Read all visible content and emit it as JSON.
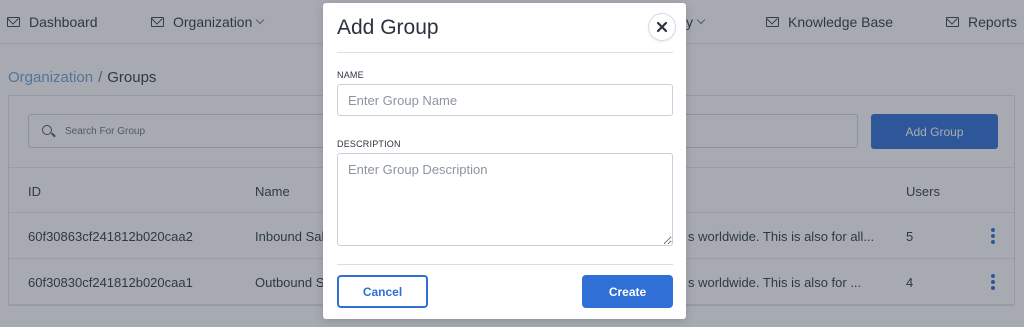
{
  "nav": {
    "items": [
      {
        "label": "Dashboard"
      },
      {
        "label": "Organization"
      },
      {
        "label": "y"
      },
      {
        "label": "Knowledge Base"
      },
      {
        "label": "Reports"
      }
    ]
  },
  "breadcrumb": {
    "parent": "Organization",
    "separator": "/",
    "current": "Groups"
  },
  "toolbar": {
    "search_placeholder": "Search For Group",
    "add_group_label": "Add Group"
  },
  "table": {
    "columns": [
      "ID",
      "Name",
      "Users"
    ],
    "rows": [
      {
        "id": "60f30863cf241812b020caa2",
        "name": "Inbound Sal",
        "description": "s worldwide. This is also for all...",
        "users": "5"
      },
      {
        "id": "60f30830cf241812b020caa1",
        "name": "Outbound S",
        "description": "s worldwide. This is also for ...",
        "users": "4"
      }
    ]
  },
  "modal": {
    "title": "Add Group",
    "name_label": "NAME",
    "name_placeholder": "Enter Group Name",
    "description_label": "DESCRIPTION",
    "description_placeholder": "Enter Group Description",
    "cancel_label": "Cancel",
    "create_label": "Create"
  },
  "colors": {
    "accent": "#2f6fd6",
    "link": "#6f9fd6",
    "overlay": "rgba(45,55,70,0.42)"
  },
  "icons": [
    "mail-icon",
    "chevron-down-icon",
    "search-icon",
    "close-icon",
    "more-vertical-icon"
  ]
}
